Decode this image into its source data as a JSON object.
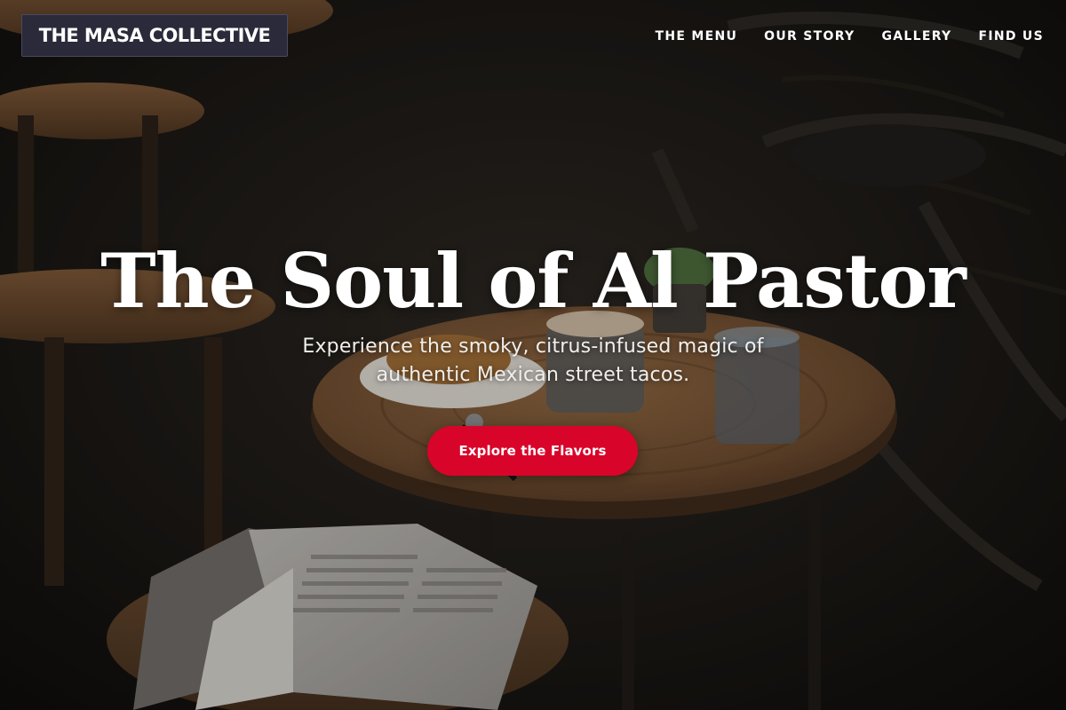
{
  "brand": {
    "name": "THE MASA COLLECTIVE"
  },
  "nav": {
    "items": [
      {
        "label": "THE MENU"
      },
      {
        "label": "OUR STORY"
      },
      {
        "label": "GALLERY"
      },
      {
        "label": "FIND US"
      }
    ]
  },
  "hero": {
    "title": "The Soul of Al Pastor",
    "subtitle": "Experience the smoky, citrus-infused magic of authentic Mexican street tacos.",
    "cta_label": "Explore the Flavors",
    "background_image": "cafe-table-photo"
  },
  "colors": {
    "accent": "#d90429",
    "logo_background": "#2a2a3a",
    "text": "#ffffff"
  }
}
